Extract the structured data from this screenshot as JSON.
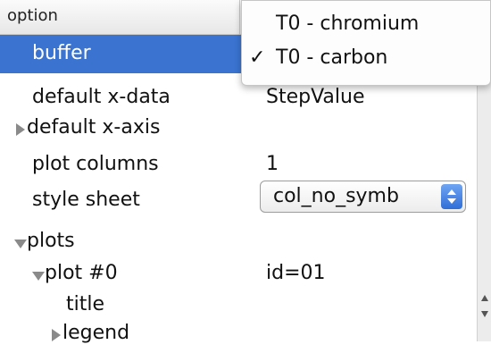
{
  "header": {
    "option_label": "option"
  },
  "rows": {
    "buffer": {
      "label": "buffer"
    },
    "default_x_data": {
      "label": "default x-data",
      "value": "StepValue"
    },
    "default_x_axis": {
      "label": "default x-axis"
    },
    "plot_columns": {
      "label": "plot columns",
      "value": "1"
    },
    "style_sheet": {
      "label": "style sheet",
      "value": "col_no_symb"
    },
    "plots": {
      "label": "plots"
    },
    "plot0": {
      "label": "plot #0",
      "value": "id=01"
    },
    "title": {
      "label": "title"
    },
    "legend": {
      "label": "legend"
    }
  },
  "popup": {
    "items": [
      {
        "label": "T0 - chromium",
        "checked": false
      },
      {
        "label": "T0 - carbon",
        "checked": true,
        "check_mark": "✓"
      }
    ]
  },
  "colors": {
    "selection": "#3a74d0",
    "accent": "#2f6ed8"
  }
}
